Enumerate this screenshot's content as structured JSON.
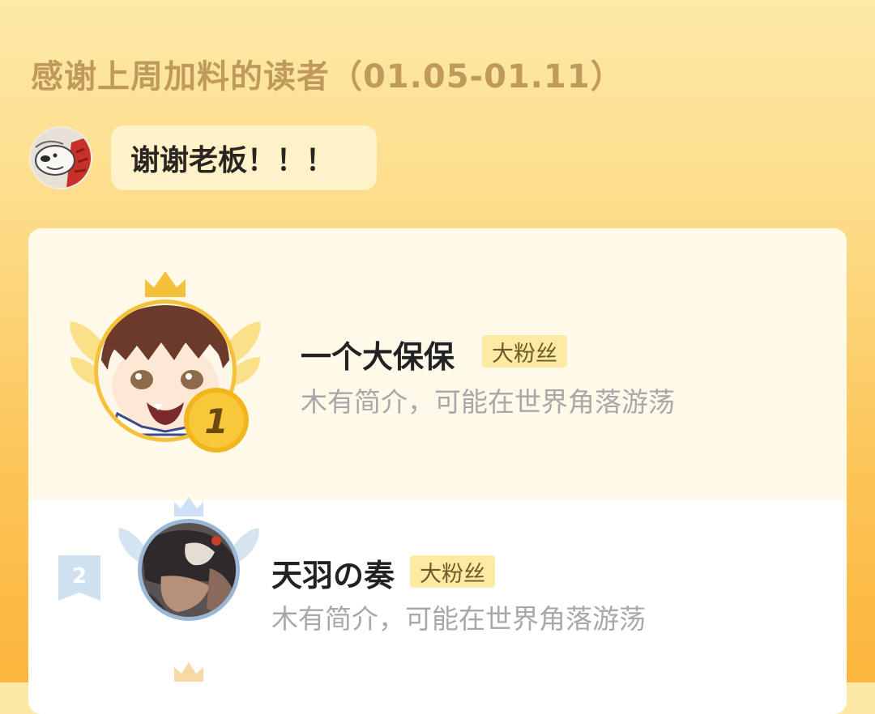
{
  "header": {
    "title": "感谢上周加料的读者（01.05-01.11）"
  },
  "author_message": {
    "text": "谢谢老板！！！"
  },
  "ranking": {
    "entries": [
      {
        "rank": "1",
        "name": "一个大保保",
        "badge": "大粉丝",
        "bio": "木有简介，可能在世界角落游荡"
      },
      {
        "rank": "2",
        "name": "天羽の奏",
        "badge": "大粉丝",
        "bio": "木有简介，可能在世界角落游荡"
      }
    ]
  },
  "colors": {
    "gold": "#f6c13a",
    "silver": "#b9d3ef",
    "title": "#bf9a5a"
  }
}
